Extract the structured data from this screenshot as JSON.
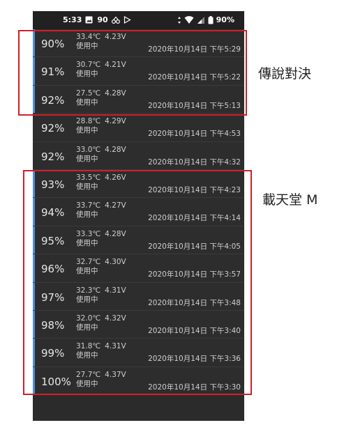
{
  "status_bar": {
    "time": "5:33",
    "notif_count": "90",
    "battery_percent": "90%"
  },
  "battery_log": [
    {
      "percent": "90%",
      "temp": "33.4℃",
      "voltage": "4.23V",
      "status": "使用中",
      "datetime": "2020年10月14日 下午5:29"
    },
    {
      "percent": "91%",
      "temp": "30.7℃",
      "voltage": "4.21V",
      "status": "使用中",
      "datetime": "2020年10月14日 下午5:22"
    },
    {
      "percent": "92%",
      "temp": "27.5℃",
      "voltage": "4.28V",
      "status": "使用中",
      "datetime": "2020年10月14日 下午5:13"
    },
    {
      "percent": "92%",
      "temp": "28.8℃",
      "voltage": "4.29V",
      "status": "使用中",
      "datetime": "2020年10月14日 下午4:53"
    },
    {
      "percent": "92%",
      "temp": "33.0℃",
      "voltage": "4.28V",
      "status": "使用中",
      "datetime": "2020年10月14日 下午4:32"
    },
    {
      "percent": "93%",
      "temp": "33.5℃",
      "voltage": "4.26V",
      "status": "使用中",
      "datetime": "2020年10月14日 下午4:23"
    },
    {
      "percent": "94%",
      "temp": "33.7℃",
      "voltage": "4.27V",
      "status": "使用中",
      "datetime": "2020年10月14日 下午4:14"
    },
    {
      "percent": "95%",
      "temp": "33.3℃",
      "voltage": "4.28V",
      "status": "使用中",
      "datetime": "2020年10月14日 下午4:05"
    },
    {
      "percent": "96%",
      "temp": "32.7℃",
      "voltage": "4.30V",
      "status": "使用中",
      "datetime": "2020年10月14日 下午3:57"
    },
    {
      "percent": "97%",
      "temp": "32.3℃",
      "voltage": "4.31V",
      "status": "使用中",
      "datetime": "2020年10月14日 下午3:48"
    },
    {
      "percent": "98%",
      "temp": "32.0℃",
      "voltage": "4.32V",
      "status": "使用中",
      "datetime": "2020年10月14日 下午3:40"
    },
    {
      "percent": "99%",
      "temp": "31.8℃",
      "voltage": "4.31V",
      "status": "使用中",
      "datetime": "2020年10月14日 下午3:36"
    },
    {
      "percent": "100%",
      "temp": "27.7℃",
      "voltage": "4.37V",
      "status": "使用中",
      "datetime": "2020年10月14日 下午3:30"
    }
  ],
  "annotations": {
    "group1_label": "傳說對決",
    "group2_label": "載天堂 M"
  },
  "colors": {
    "highlight": "#d0202a",
    "accent": "#4a90e2",
    "row_bg": "#2d2d2d"
  }
}
